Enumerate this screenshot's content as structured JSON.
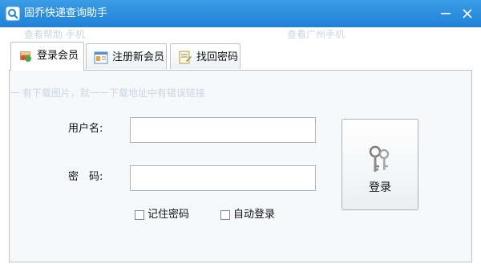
{
  "window": {
    "title": "固乔快递查询助手",
    "minimize_icon": "minimize-icon",
    "close_icon": "close-icon"
  },
  "background_ghost": {
    "line1": "查看帮助    手机",
    "line2": "查看广州手机",
    "line3": "一    有下载图片，就一一下载地址中有错误链接"
  },
  "tabs": [
    {
      "label": "登录会员",
      "icon": "member-login-icon",
      "active": true
    },
    {
      "label": "注册新会员",
      "icon": "register-icon",
      "active": false
    },
    {
      "label": "找回密码",
      "icon": "recover-password-icon",
      "active": false
    }
  ],
  "form": {
    "username_label": "用户名:",
    "username_value": "",
    "password_label": "密　码:",
    "password_value": "",
    "login_button_label": "登录",
    "remember_password_label": "记住密码",
    "remember_password_checked": false,
    "auto_login_label": "自动登录",
    "auto_login_checked": false
  },
  "colors": {
    "titlebar": "#2a8fe0",
    "border": "#b9c3cd",
    "panel_bg": "#f6f8fa"
  }
}
